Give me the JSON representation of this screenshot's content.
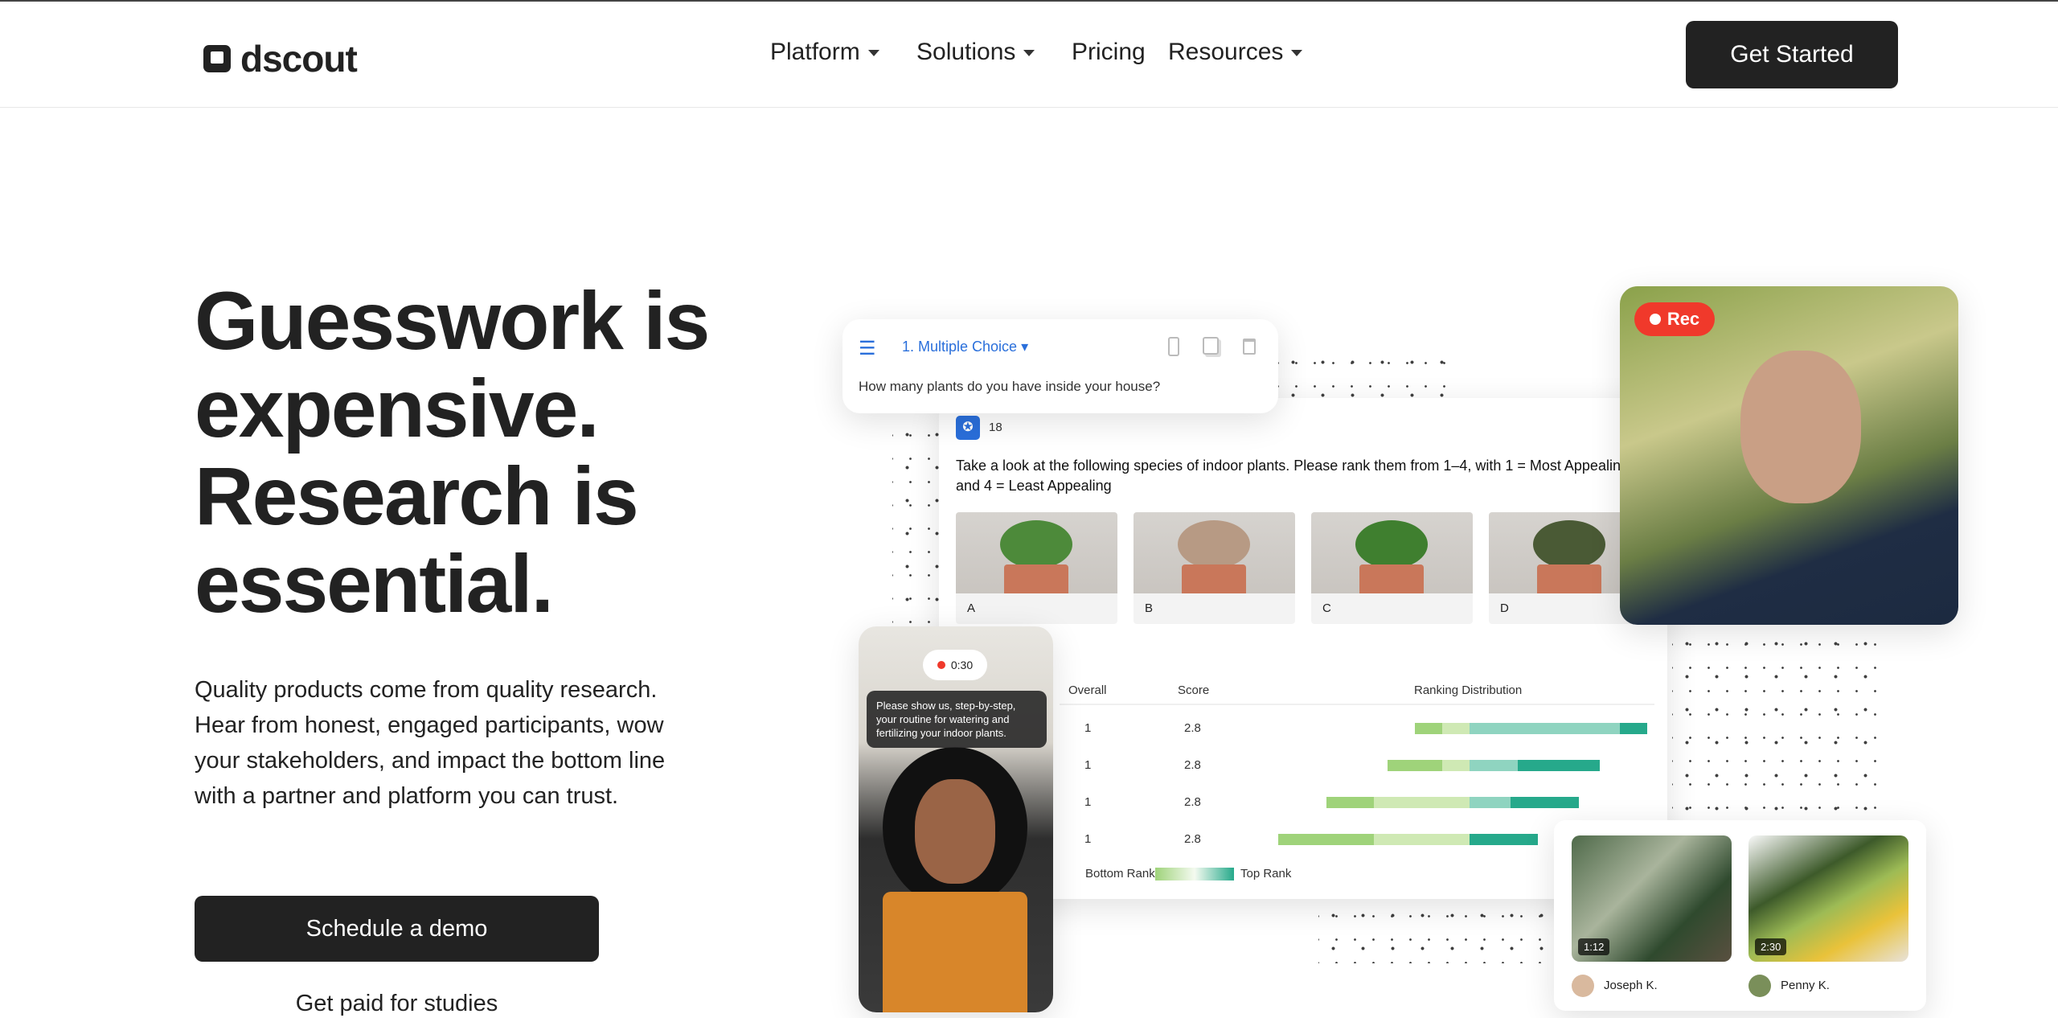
{
  "header": {
    "logo": "dscout",
    "nav": [
      {
        "label": "Platform",
        "dropdown": true
      },
      {
        "label": "Solutions",
        "dropdown": true
      },
      {
        "label": "Pricing",
        "dropdown": false
      },
      {
        "label": "Resources",
        "dropdown": true
      }
    ],
    "cta": "Get Started"
  },
  "hero": {
    "headline": [
      "Guesswork is",
      "expensive.",
      "Research is",
      "essential."
    ],
    "lead": "Quality products come from quality research. Hear from honest, engaged participants, wow your stakeholders, and impact the bottom line with a partner and platform you can trust.",
    "primary_cta": "Schedule a demo",
    "secondary_link": "Get paid for studies"
  },
  "question_card": {
    "type": "1. Multiple Choice",
    "question": "How many plants do you have inside your house?",
    "icons": [
      "list-icon",
      "mobile-icon",
      "copy-icon",
      "trash-icon"
    ],
    "accent": "#2a6fdb"
  },
  "rank_card": {
    "badge_count": "18",
    "prompt": "Take a look at the following species of indoor plants. Please rank them from 1–4, with 1 = Most Appealing and 4 = Least Appealing",
    "options": [
      "A",
      "B",
      "C",
      "D"
    ],
    "table": {
      "headers": [
        "Overall",
        "Score",
        "Ranking Distribution"
      ],
      "rows": [
        {
          "overall": "1",
          "score": "2.8",
          "distribution": [
            2,
            2,
            11,
            2
          ]
        },
        {
          "overall": "1",
          "score": "2.8",
          "distribution": [
            4,
            2,
            3.5,
            6
          ]
        },
        {
          "overall": "1",
          "score": "2.8",
          "distribution": [
            3.5,
            7,
            3,
            5
          ]
        },
        {
          "overall": "1",
          "score": "2.8",
          "distribution": [
            7,
            7,
            0,
            5
          ]
        }
      ]
    },
    "legend": {
      "low": "Bottom Rank",
      "high": "Top Rank"
    },
    "colors": [
      "#9fd37a",
      "#cfe9b4",
      "#8fd4c0",
      "#26a98b"
    ]
  },
  "phone": {
    "timer": "0:30",
    "prompt": "Please show us, step-by-step, your routine for watering and fertilizing your indoor plants.",
    "rec_color": "#f0392b"
  },
  "interview": {
    "rec_label": "Rec",
    "rec_color": "#f0392b"
  },
  "videos": [
    {
      "duration": "1:12",
      "name": "Joseph K."
    },
    {
      "duration": "2:30",
      "name": "Penny K."
    }
  ]
}
